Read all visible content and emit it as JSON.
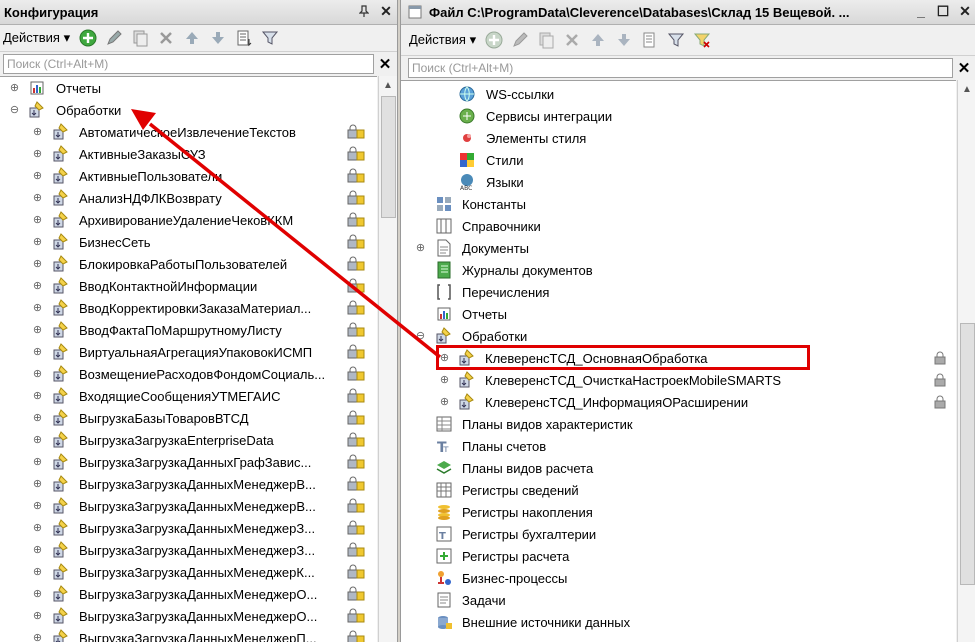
{
  "left_panel": {
    "title": "Конфигурация",
    "actions_label": "Действия",
    "search_placeholder": "Поиск (Ctrl+Alt+M)",
    "tree": {
      "reports": "Отчеты",
      "processing": "Обработки",
      "items": [
        "АвтоматическоеИзвлечениеТекстов",
        "АктивныеЗаказыСУЗ",
        "АктивныеПользователи",
        "АнализНДФЛКВозврату",
        "АрхивированиеУдалениеЧековККМ",
        "БизнесСеть",
        "БлокировкаРаботыПользователей",
        "ВводКонтактнойИнформации",
        "ВводКорректировкиЗаказаМатериал...",
        "ВводФактаПоМаршрутномуЛисту",
        "ВиртуальнаяАгрегацияУпаковокИСМП",
        "ВозмещениеРасходовФондомСоциаль...",
        "ВходящиеСообщенияУТМЕГАИС",
        "ВыгрузкаБазыТоваровВТСД",
        "ВыгрузкаЗагрузкаEnterpriseData",
        "ВыгрузкаЗагрузкаДанныхГрафЗавис...",
        "ВыгрузкаЗагрузкаДанныхМенеджерВ...",
        "ВыгрузкаЗагрузкаДанныхМенеджерВ...",
        "ВыгрузкаЗагрузкаДанныхМенеджерЗ...",
        "ВыгрузкаЗагрузкаДанныхМенеджерЗ...",
        "ВыгрузкаЗагрузкаДанныхМенеджерК...",
        "ВыгрузкаЗагрузкаДанныхМенеджерО...",
        "ВыгрузкаЗагрузкаДанныхМенеджерО...",
        "ВыгрузкаЗагрузкаДанныхМенеджерП..."
      ]
    }
  },
  "right_panel": {
    "title": "Файл C:\\ProgramData\\Cleverence\\Databases\\Склад 15 Вещевой. ...",
    "actions_label": "Действия",
    "search_placeholder": "Поиск (Ctrl+Alt+M)",
    "tree": {
      "general_children": [
        "WS-ссылки",
        "Сервисы интеграции",
        "Элементы стиля",
        "Стили",
        "Языки"
      ],
      "top": [
        "Константы",
        "Справочники",
        "Документы",
        "Журналы документов",
        "Перечисления",
        "Отчеты",
        "Обработки"
      ],
      "processing_children": [
        "КлеверенсТСД_ОсновнаяОбработка",
        "КлеверенсТСД_ОчисткаНастроекMobileSMARTS",
        "КлеверенсТСД_ИнформацияОРасширении"
      ],
      "bottom": [
        "Планы видов характеристик",
        "Планы счетов",
        "Планы видов расчета",
        "Регистры сведений",
        "Регистры накопления",
        "Регистры бухгалтерии",
        "Регистры расчета",
        "Бизнес-процессы",
        "Задачи",
        "Внешние источники данных"
      ]
    }
  },
  "colors": {
    "highlight": "#e00000",
    "arrow": "#e00000"
  }
}
